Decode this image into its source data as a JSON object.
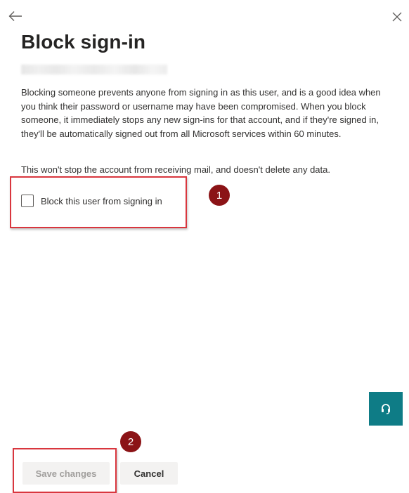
{
  "panel": {
    "title": "Block sign-in",
    "description": "Blocking someone prevents anyone from signing in as this user, and is a good idea when you think their password or username may have been compromised. When you block someone, it immediately stops any new sign-ins for that account, and if they're signed in, they'll be automatically signed out from all Microsoft services within 60 minutes.",
    "note": "This won't stop the account from receiving mail, and doesn't delete any data."
  },
  "block_checkbox": {
    "label": "Block this user from signing in",
    "checked": false
  },
  "annotations": {
    "step_1": "1",
    "step_2": "2",
    "box_color": "#d9363e",
    "marker_color": "#8b1316"
  },
  "footer": {
    "save_label": "Save changes",
    "save_disabled": true,
    "cancel_label": "Cancel"
  },
  "icons": {
    "back": "back-arrow-icon",
    "close": "close-icon",
    "help": "headset-help-icon"
  },
  "colors": {
    "help_fab": "#0e7c86"
  }
}
